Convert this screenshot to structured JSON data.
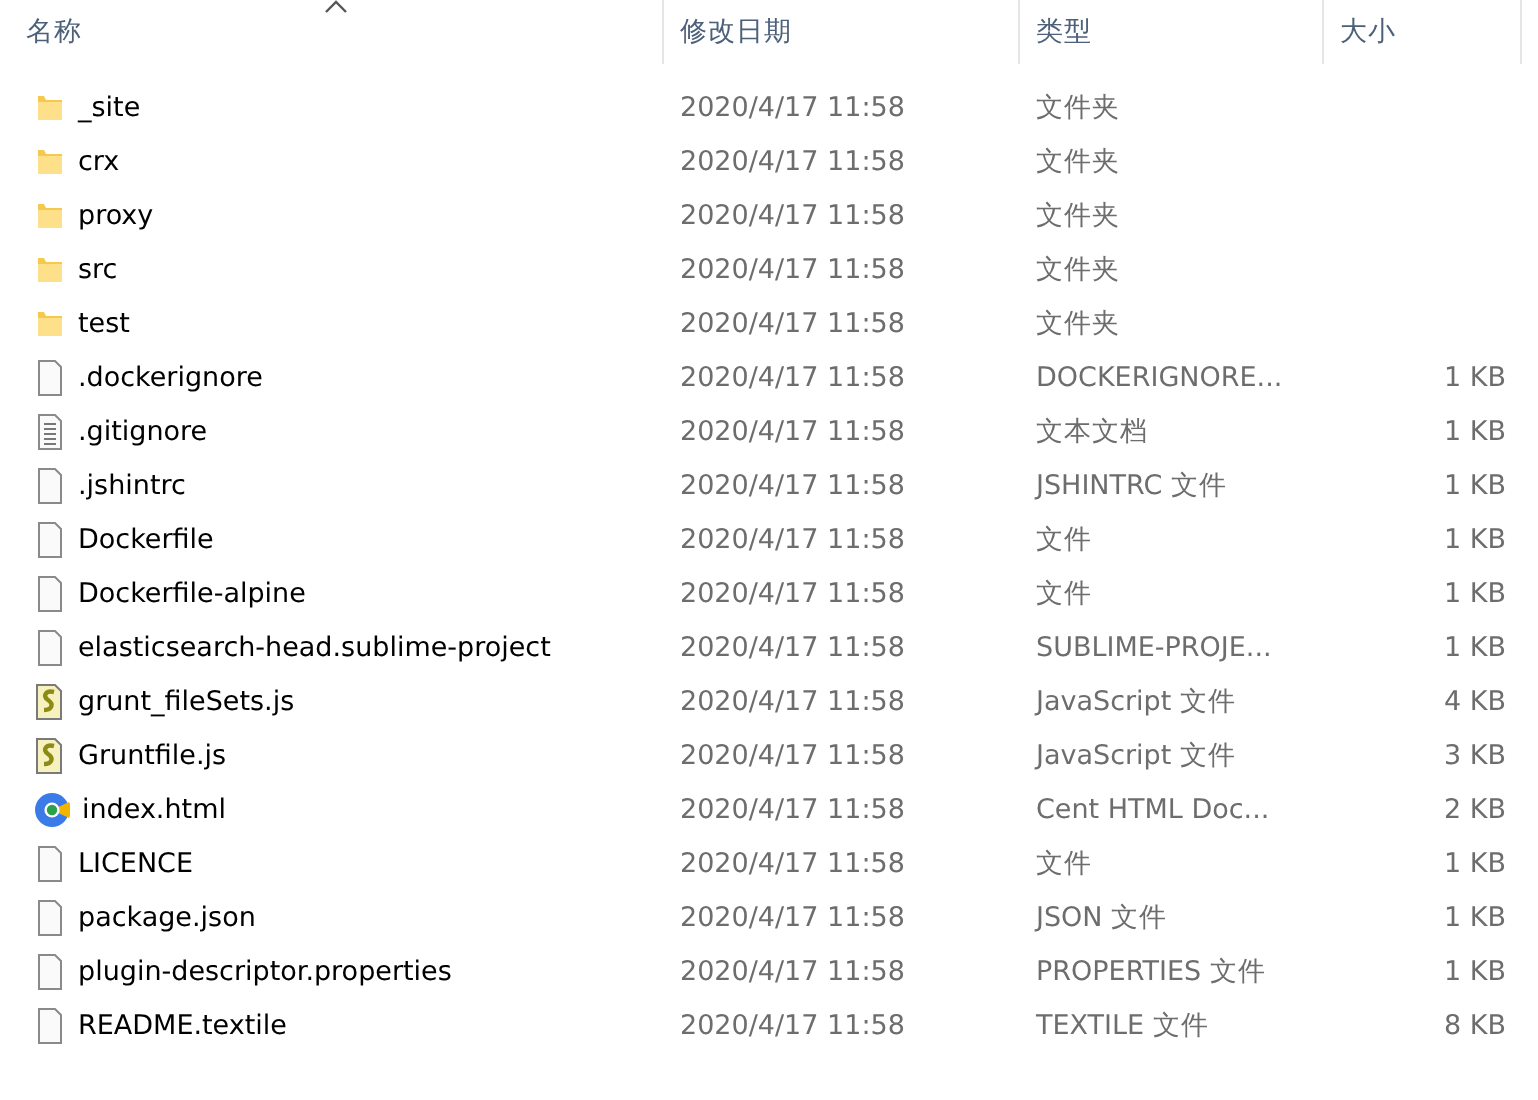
{
  "columns": [
    {
      "label": "名称",
      "sorted": true
    },
    {
      "label": "修改日期",
      "sorted": false
    },
    {
      "label": "类型",
      "sorted": false
    },
    {
      "label": "大小",
      "sorted": false
    }
  ],
  "rows": [
    {
      "kind": "folder",
      "name": "_site",
      "date": "2020/4/17 11:58",
      "type": "文件夹"
    },
    {
      "kind": "folder",
      "name": "crx",
      "date": "2020/4/17 11:58",
      "type": "文件夹"
    },
    {
      "kind": "folder",
      "name": "proxy",
      "date": "2020/4/17 11:58",
      "type": "文件夹"
    },
    {
      "kind": "folder",
      "name": "src",
      "date": "2020/4/17 11:58",
      "type": "文件夹"
    },
    {
      "kind": "folder",
      "name": "test",
      "date": "2020/4/17 11:58",
      "type": "文件夹"
    },
    {
      "kind": "file",
      "name": ".dockerignore",
      "date": "2020/4/17 11:58",
      "type": "DOCKERIGNORE...",
      "size": "1 KB"
    },
    {
      "kind": "text",
      "name": ".gitignore",
      "date": "2020/4/17 11:58",
      "type": "文本文档",
      "size": "1 KB"
    },
    {
      "kind": "file",
      "name": ".jshintrc",
      "date": "2020/4/17 11:58",
      "type": "JSHINTRC 文件",
      "size": "1 KB"
    },
    {
      "kind": "file",
      "name": "Dockerfile",
      "date": "2020/4/17 11:58",
      "type": "文件",
      "size": "1 KB"
    },
    {
      "kind": "file",
      "name": "Dockerfile-alpine",
      "date": "2020/4/17 11:58",
      "type": "文件",
      "size": "1 KB"
    },
    {
      "kind": "file",
      "name": "elasticsearch-head.sublime-project",
      "date": "2020/4/17 11:58",
      "type": "SUBLIME-PROJE...",
      "size": "1 KB"
    },
    {
      "kind": "script",
      "name": "grunt_fileSets.js",
      "date": "2020/4/17 11:58",
      "type": "JavaScript 文件",
      "size": "4 KB"
    },
    {
      "kind": "script",
      "name": "Gruntfile.js",
      "date": "2020/4/17 11:58",
      "type": "JavaScript 文件",
      "size": "3 KB"
    },
    {
      "kind": "browser",
      "name": "index.html",
      "date": "2020/4/17 11:58",
      "type": "Cent HTML Doc...",
      "size": "2 KB"
    },
    {
      "kind": "file",
      "name": "LICENCE",
      "date": "2020/4/17 11:58",
      "type": "文件",
      "size": "1 KB"
    },
    {
      "kind": "file",
      "name": "package.json",
      "date": "2020/4/17 11:58",
      "type": "JSON 文件",
      "size": "1 KB"
    },
    {
      "kind": "file",
      "name": "plugin-descriptor.properties",
      "date": "2020/4/17 11:58",
      "type": "PROPERTIES 文件",
      "size": "1 KB"
    },
    {
      "kind": "file",
      "name": "README.textile",
      "date": "2020/4/17 11:58",
      "type": "TEXTILE 文件",
      "size": "8 KB"
    }
  ]
}
